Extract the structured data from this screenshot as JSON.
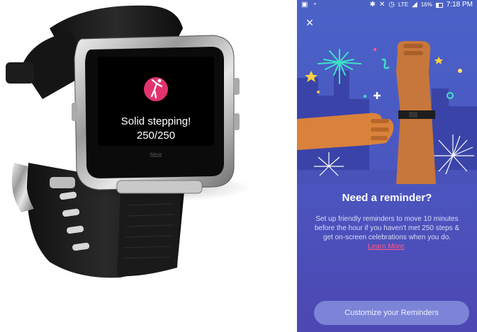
{
  "watch": {
    "screen_message": "Solid stepping!",
    "screen_progress": "250/250",
    "brand_label": "fitbit",
    "icon": "person-stretching-icon",
    "accent_color": "#e2336f"
  },
  "phone": {
    "status_bar": {
      "time": "7:18 PM",
      "battery": "16%",
      "network": "LTE",
      "icons": [
        "fitbit-app-icon",
        "notification-icon",
        "bluetooth-icon",
        "mute-icon",
        "alarm-icon",
        "signal-icon",
        "battery-icon"
      ]
    },
    "close_label": "×",
    "dialog": {
      "title": "Need a reminder?",
      "body": "Set up friendly reminders to move 10 minutes before the hour if you haven't met 250 steps & get on-screen celebrations when you do.",
      "learn_more": "Learn More",
      "period": "."
    },
    "cta_label": "Customize your Reminders",
    "colors": {
      "background": "#4b55bf",
      "link": "#ff5a87",
      "button": "#7c84d8"
    }
  }
}
